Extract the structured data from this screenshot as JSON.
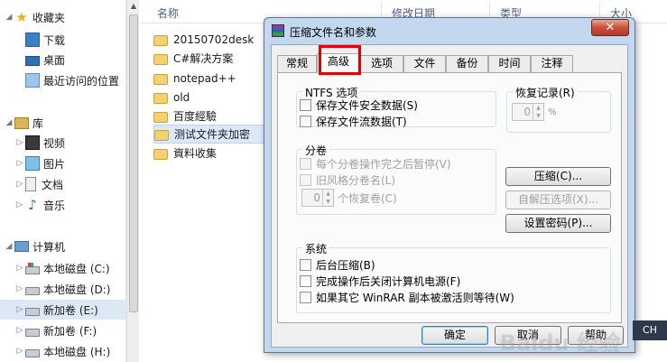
{
  "nav": {
    "favorites": "收藏夹",
    "downloads": "下载",
    "desktop": "桌面",
    "recent": "最近访问的位置",
    "libraries": "库",
    "videos": "视频",
    "pictures": "图片",
    "documents": "文档",
    "music": "音乐",
    "computer": "计算机",
    "drives": [
      "本地磁盘 (C:)",
      "本地磁盘 (D:)",
      "新加卷 (E:)",
      "新加卷 (F:)",
      "本地磁盘 (H:)"
    ]
  },
  "filelist": {
    "columns": {
      "name": "名称",
      "modified": "修改日期",
      "type": "类型",
      "size": "大小"
    },
    "items": [
      "20150702desk",
      "C#解决方案",
      "notepad++",
      "old",
      "百度經驗",
      "测试文件夹加密",
      "資料收集"
    ]
  },
  "dialog": {
    "title": "压缩文件名和参数",
    "close_glyph": "✕",
    "tabs": [
      "常规",
      "高级",
      "选项",
      "文件",
      "备份",
      "时间",
      "注释"
    ],
    "ntfs": {
      "title": "NTFS 选项",
      "save_security": "保存文件安全数据(S)",
      "save_streams": "保存文件流数据(T)"
    },
    "recovery": {
      "title": "恢复记录(R)",
      "value": "0",
      "unit": "%"
    },
    "volumes": {
      "title": "分卷",
      "pause": "每个分卷操作完之后暂停(V)",
      "old_style": "旧风格分卷名(L)",
      "recovery_volumes_value": "0",
      "recovery_volumes_label": "个恢复卷(C)"
    },
    "compression_button": "压缩(C)...",
    "sfx_button": "自解压选项(X)...",
    "password_button": "设置密码(P)...",
    "system": {
      "title": "系统",
      "background": "后台压缩(B)",
      "shutdown": "完成操作后关闭计算机电源(F)",
      "wait": "如果其它 WinRAR 副本被激活则等待(W)"
    },
    "ok": "确定",
    "cancel": "取消",
    "help": "帮助"
  },
  "watermark": "Baidu 经验",
  "tray": "CH"
}
